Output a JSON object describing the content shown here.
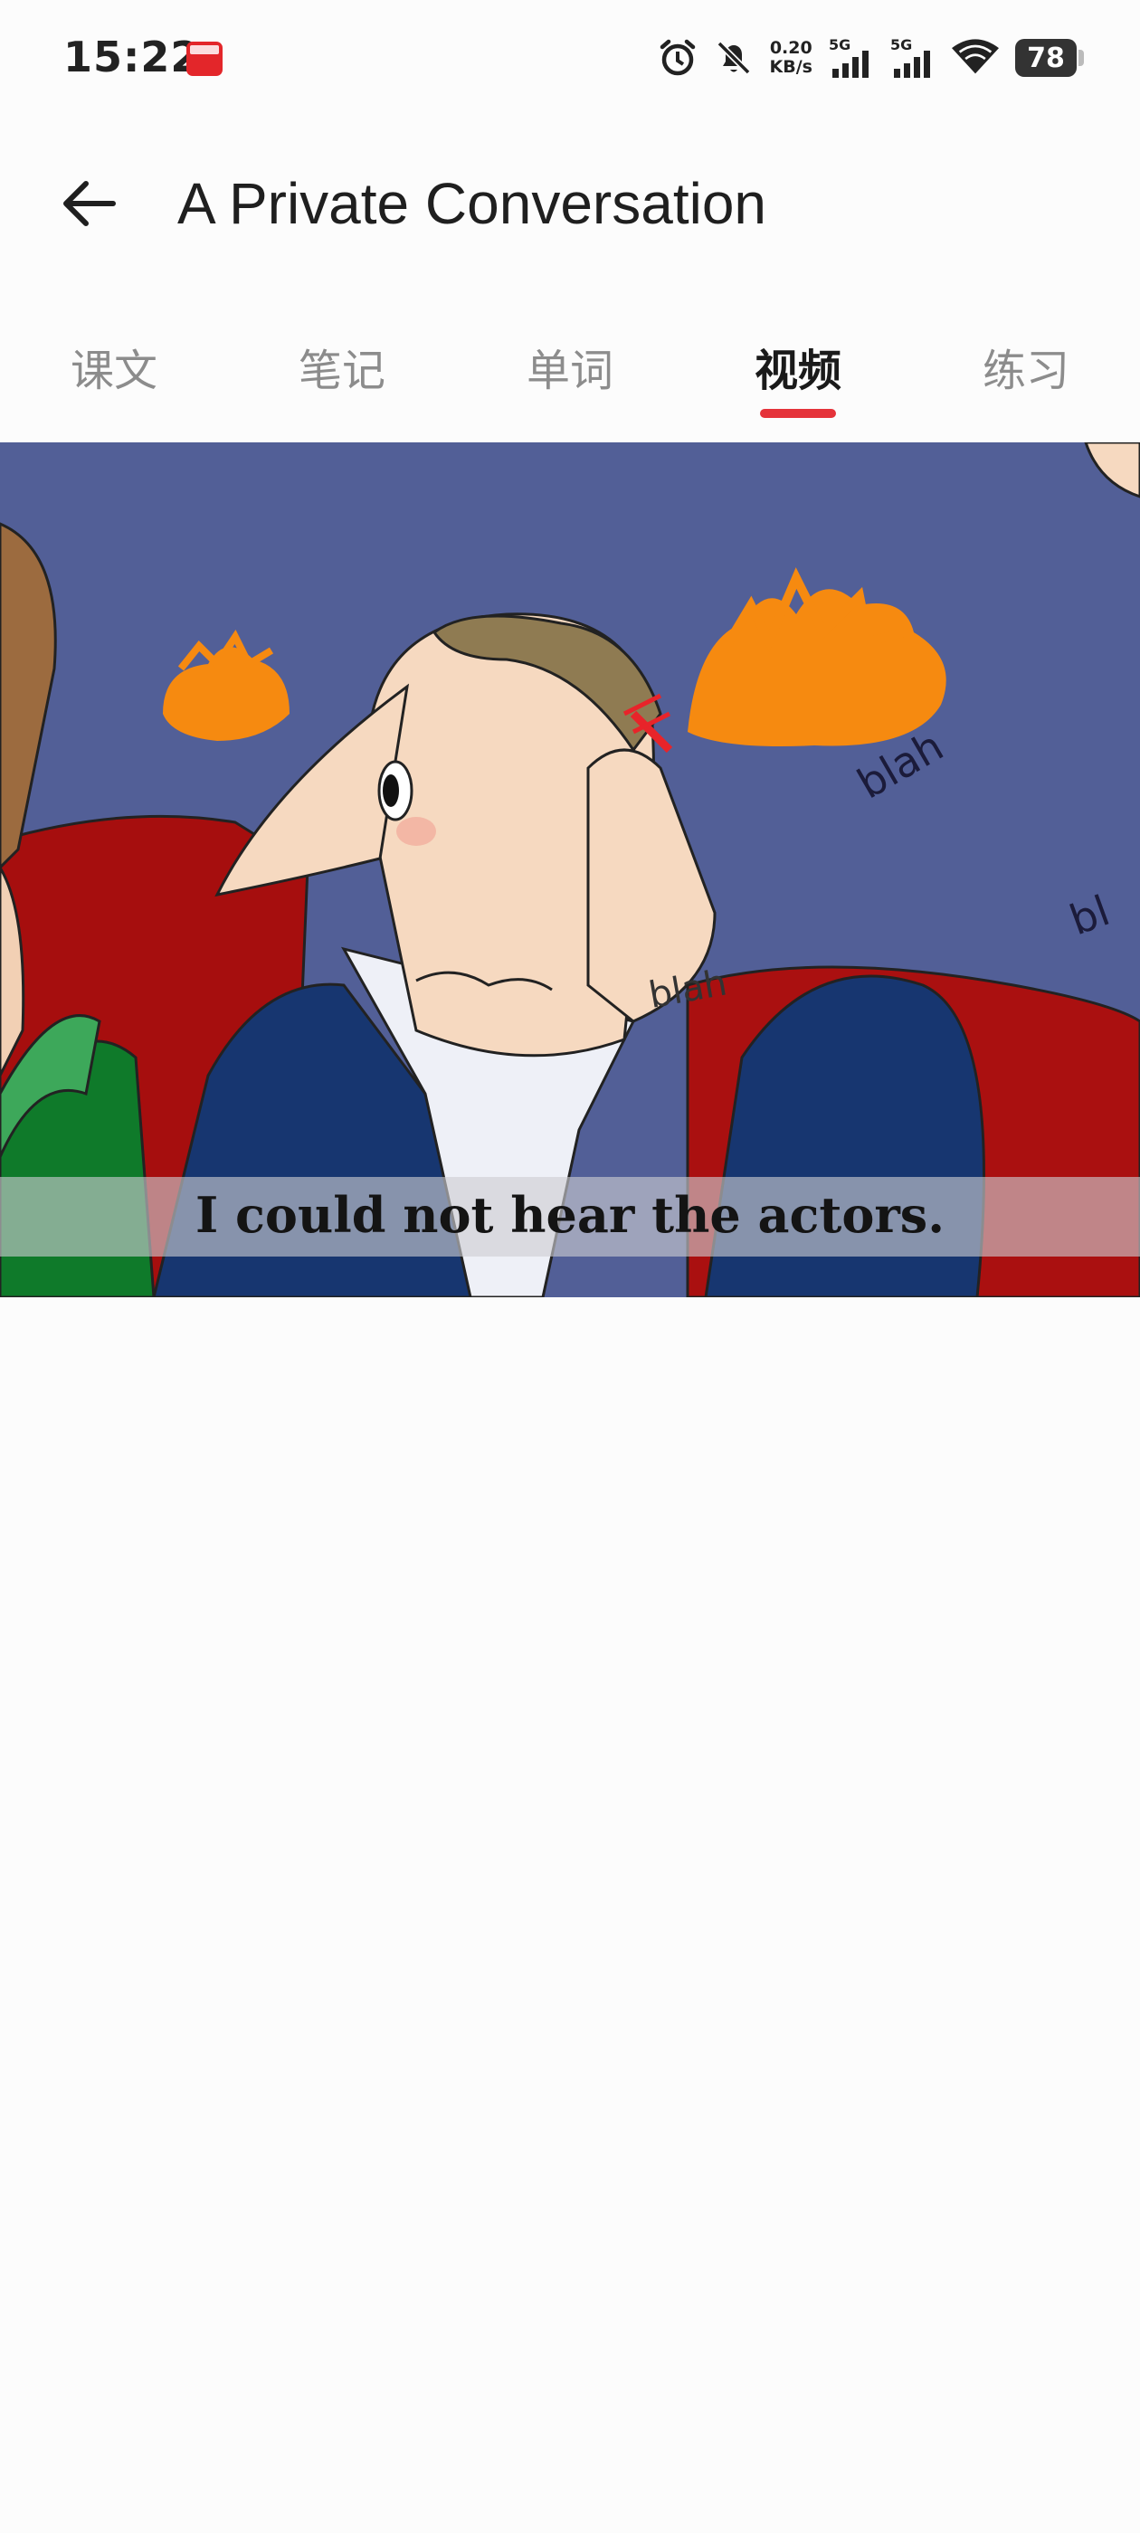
{
  "status_bar": {
    "time": "15:22",
    "app_icon": "app-notification-icon",
    "network_speed_value": "0.20",
    "network_speed_unit": "KB/s",
    "sim1_label": "5G",
    "sim2_label": "5G",
    "battery_level": "78",
    "icons": [
      "alarm-icon",
      "mute-bell-icon",
      "signal-icon",
      "signal-icon",
      "wifi-icon",
      "battery-icon"
    ]
  },
  "header": {
    "back_icon": "back-arrow-icon",
    "title": "A Private Conversation"
  },
  "tabs": [
    {
      "label": "课文",
      "active": false
    },
    {
      "label": "笔记",
      "active": false
    },
    {
      "label": "单词",
      "active": false
    },
    {
      "label": "视频",
      "active": true
    },
    {
      "label": "练习",
      "active": false
    }
  ],
  "video": {
    "subtitle": "I could not hear the actors.",
    "drawn_text": [
      "blah",
      "bl",
      "blah"
    ]
  },
  "colors": {
    "accent": "#e5333a",
    "text_primary": "#1a1a1a",
    "tab_inactive": "#8c8c8c",
    "background": "#fcfcfc"
  }
}
